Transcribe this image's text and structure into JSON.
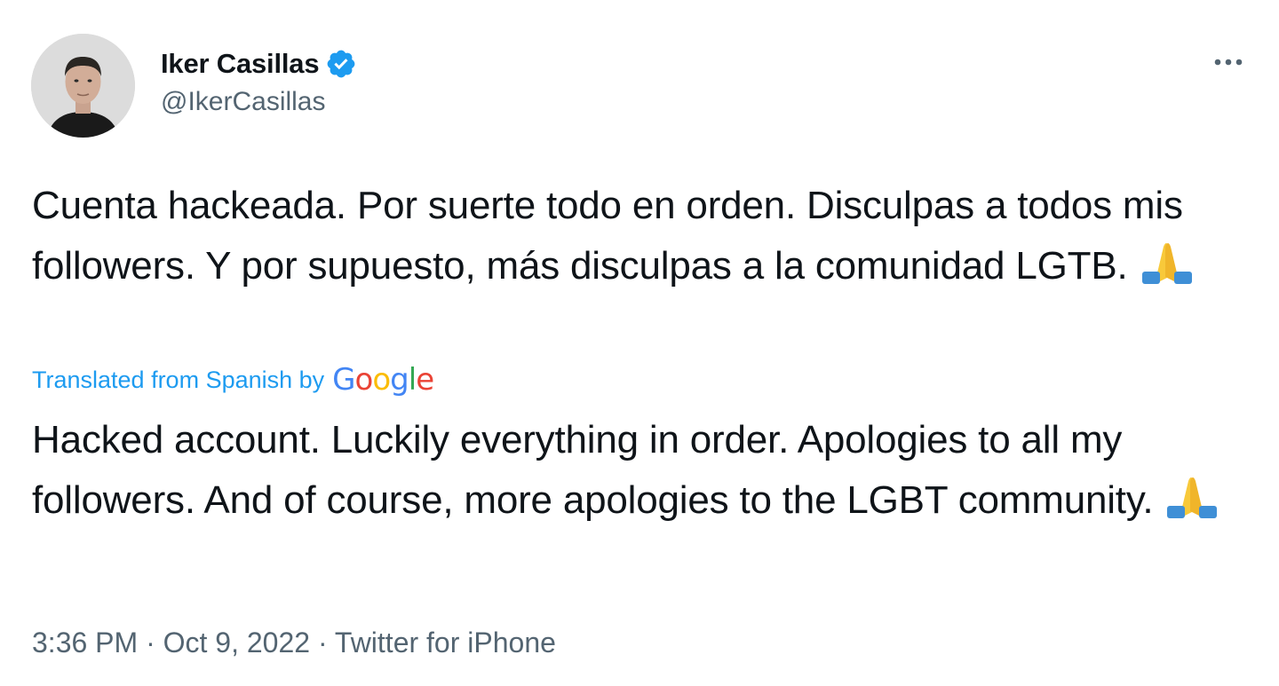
{
  "author": {
    "display_name": "Iker Casillas",
    "handle": "@IkerCasillas",
    "verified": true
  },
  "tweet": {
    "text": "Cuenta hackeada. Por suerte todo en orden. Disculpas a todos mis followers. Y por supuesto, más disculpas a la comunidad LGTB.",
    "emoji": "folded-hands-icon",
    "translation_label": "Translated from Spanish by",
    "translator_logo": "Google",
    "translation_text": "Hacked account. Luckily everything in order. Apologies to all my followers. And of course, more apologies to the LGBT community.",
    "time": "3:36 PM",
    "separator": "·",
    "date": "Oct 9, 2022",
    "source": "Twitter for iPhone"
  },
  "colors": {
    "text_primary": "#0f1419",
    "text_secondary": "#536471",
    "accent": "#1d9bf0",
    "google_blue": "#4285F4",
    "google_red": "#EA4335",
    "google_yellow": "#FBBC05",
    "google_green": "#34A853"
  }
}
